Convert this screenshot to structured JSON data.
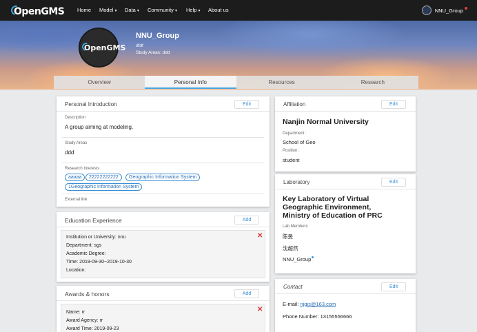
{
  "nav": {
    "logo": "OpenGMS",
    "items": [
      {
        "label": "Home",
        "dropdown": false
      },
      {
        "label": "Model",
        "dropdown": true
      },
      {
        "label": "Data",
        "dropdown": true
      },
      {
        "label": "Community",
        "dropdown": true
      },
      {
        "label": "Help",
        "dropdown": true
      },
      {
        "label": "About us",
        "dropdown": false
      }
    ],
    "user": "NNU_Group"
  },
  "profile": {
    "avatar_text": "OpenGMS",
    "name": "NNU_Group",
    "subtitle": "dfdf",
    "study_areas": "Study Areas: ddd"
  },
  "tabs": [
    "Overview",
    "Personal Info",
    "Resources",
    "Research"
  ],
  "active_tab": "Personal Info",
  "personal_intro": {
    "title": "Personal Introduction",
    "edit": "Edit",
    "description_label": "Description",
    "description": "A group aiming at modeling.",
    "study_areas_label": "Study Areas",
    "study_areas": "ddd",
    "interests_label": "Research Interests",
    "interests": [
      "aaaaa",
      "22222222222",
      "Geographic Information System",
      "1Geographic Information System"
    ],
    "external_link_label": "External link"
  },
  "education": {
    "title": "Education Experience",
    "add": "Add",
    "institution": "Institution or University:   nnu",
    "department": "Department:   sgs",
    "degree": "Academic Degree:",
    "time": "Time:   2019-09-30~2019-10-30",
    "location": "Location:"
  },
  "awards": {
    "title": "Awards & honors",
    "add": "Add",
    "name": "Name:   rr",
    "agency": "Award Agency:   rr",
    "time": "Award Time:   2019-09-23"
  },
  "affiliation": {
    "title": "Affiliation",
    "edit": "Edit",
    "org": "Nanjin Normal University",
    "department_label": "Department :",
    "department": "School of Geo",
    "position_label": "Position :",
    "position": "student"
  },
  "laboratory": {
    "title": "Laboratory",
    "edit": "Edit",
    "name_line1": "Key Laboratory of Virtual",
    "name_line2": "Geographic Environment,",
    "name_line3": "Ministry of Education of PRC",
    "members_label": "Lab Members",
    "members": [
      "陈旻",
      "沈超然",
      "NNU_Group"
    ]
  },
  "contact": {
    "title": "Contact",
    "edit": "Edit",
    "email_label": "E-mail:",
    "email": "njgis@163.com",
    "phone": "Phone Number: 13155556666"
  },
  "colors": {
    "accent": "#3a8fd6",
    "danger": "#d93a3a",
    "nav_bg": "#1c1c1c"
  }
}
